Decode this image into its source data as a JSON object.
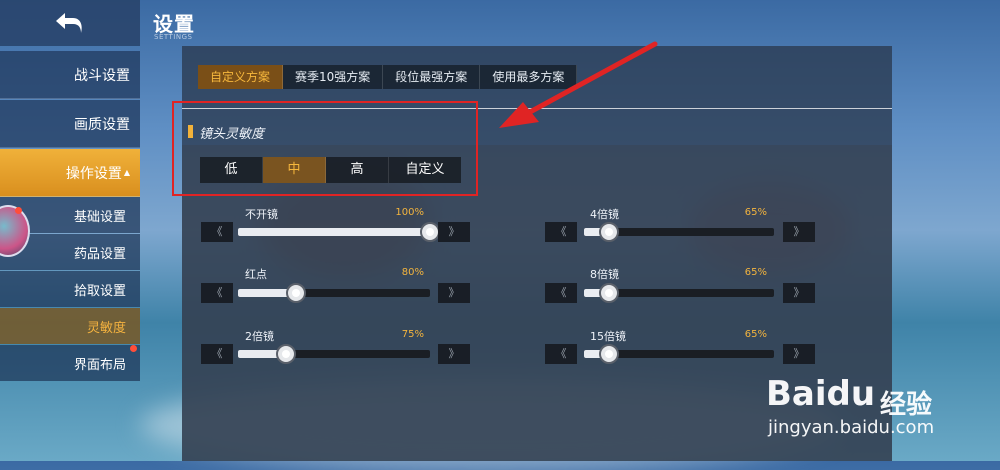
{
  "header": {
    "title": "设置",
    "subtitle": "SETTINGS"
  },
  "sidebar": {
    "items": [
      {
        "label": "战斗设置"
      },
      {
        "label": "画质设置"
      },
      {
        "label": "操作设置"
      }
    ],
    "sub_items": [
      {
        "label": "基础设置"
      },
      {
        "label": "药品设置"
      },
      {
        "label": "拾取设置"
      },
      {
        "label": "灵敏度"
      },
      {
        "label": "界面布局"
      }
    ],
    "active_item": "操作设置",
    "active_sub_item": "灵敏度"
  },
  "scheme_tabs": [
    {
      "label": "自定义方案"
    },
    {
      "label": "赛季10强方案"
    },
    {
      "label": "段位最强方案"
    },
    {
      "label": "使用最多方案"
    }
  ],
  "active_scheme": "自定义方案",
  "section": {
    "title": "镜头灵敏度"
  },
  "sensitivity_presets": [
    {
      "label": "低"
    },
    {
      "label": "中"
    },
    {
      "label": "高"
    },
    {
      "label": "自定义"
    }
  ],
  "active_preset": "中",
  "sliders": [
    {
      "label": "不开镜",
      "value": "100%",
      "level": 1.0
    },
    {
      "label": "红点",
      "value": "80%",
      "level": 0.3
    },
    {
      "label": "2倍镜",
      "value": "75%",
      "level": 0.25
    },
    {
      "label": "4倍镜",
      "value": "65%",
      "level": 0.13
    },
    {
      "label": "8倍镜",
      "value": "65%",
      "level": 0.13
    },
    {
      "label": "15倍镜",
      "value": "65%",
      "level": 0.13
    }
  ],
  "arrow_glyphs": {
    "left": "《",
    "right": "》"
  },
  "watermark": {
    "logo": "Baidu",
    "cn": "经验",
    "url": "jingyan.baidu.com"
  },
  "colors": {
    "accent": "#f2b23a",
    "annotation": "#e02424",
    "panel": "#2a3a50"
  }
}
